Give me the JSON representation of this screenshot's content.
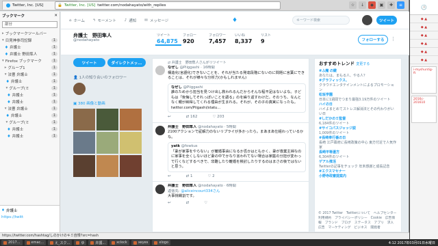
{
  "browser": {
    "tab_label": "Twitter, Inc. [US]",
    "url_site": "Twitter, Inc. [US]",
    "url": "twitter.com/nodahayato/with_replies",
    "status_url": "https://twitter.com/hashtag/しのかけのキミ自慢?src=hash"
  },
  "sidebar": {
    "title": "ブックマーク",
    "close": "✕",
    "search": "部分",
    "items": [
      {
        "label": "ブックマークツールバー",
        "count": ""
      },
      {
        "label": "日見神参司記録",
        "count": "1"
      },
      {
        "label": "弁護士",
        "count": "1"
      },
      {
        "label": "弁護士 野田隼人",
        "count": "1"
      },
      {
        "label": "Firefox ブックマーク",
        "count": "1"
      },
      {
        "label": "グループ1",
        "count": "1"
      },
      {
        "label": "法曹 弁護士",
        "count": "1"
      },
      {
        "label": "弁護士",
        "count": "1"
      },
      {
        "label": "グループ(ミ",
        "count": "1"
      },
      {
        "label": "弁護士",
        "count": "1"
      },
      {
        "label": "弁護士",
        "count": "1"
      },
      {
        "label": "法曹 弁護士",
        "count": "1"
      },
      {
        "label": "弁護士",
        "count": "1"
      },
      {
        "label": "グループ(ミ",
        "count": "1"
      },
      {
        "label": "弁護士",
        "count": "1"
      },
      {
        "label": "弁護士",
        "count": "1"
      }
    ],
    "bottom_name": "弁護士",
    "bottom_link": "https://twitt"
  },
  "nav": {
    "home": "ホーム",
    "moments": "モーメント",
    "notifications": "通知",
    "messages": "メッセージ",
    "search_placeholder": "キーワード検索",
    "tweet_button": "ツイート"
  },
  "profile": {
    "name": "弁護士　野田隼人",
    "handle": "@nodahayato",
    "stats": [
      {
        "label": "ツイート",
        "value": "64,875"
      },
      {
        "label": "フォロー",
        "value": "920"
      },
      {
        "label": "フォロワー",
        "value": "7,457"
      },
      {
        "label": "いいね",
        "value": "8,337"
      },
      {
        "label": "リスト",
        "value": "9"
      }
    ],
    "follow_button": "フォローする",
    "more": "⋮",
    "tweet_to": "ツイート",
    "dm": "ダイレクトメッ...",
    "known_followers": "1人の知り合いのフォロワー",
    "media_link": "380 画像と動画"
  },
  "feed": {
    "tweets": [
      {
        "context": "弁護士　野田隼人さんがリツイート",
        "name": "なぜし",
        "meta": "@Piiggashi · 16時間",
        "text": "構造化(言語化)できないことを、それが当たる発達段階にないのに問題に言葉にできることは、それが様々な分析力(かもしれません)",
        "quote_name": "なぜし",
        "quote_handle": "@Piiggashi",
        "quote_text": "誰のためから担当を見つけ出し救われるんだからそんな程不足はないよな。子どもは「後悔してそれっぽいことを語る」のを繰り返すわけだ。そのうち、なんとなく親が納得してくれる理由が生まれる。それが、その子の真実になったも。twitter.com/Piigashi/statu...",
        "replies": "↩",
        "retweets": "⇄ 162",
        "likes": "♡ 203"
      },
      {
        "context": "",
        "name": "弁護士　野田隼人",
        "meta": "@nodahayato · 5時間",
        "text": "2100アクションで証解力のないリプライが多かったら。まあまあ仕組わっているかな。",
        "quote_name": "yatk",
        "quote_handle": "@fewkus",
        "quote_text": "「妻が家事をやらない」が離婚事由になるか否かはともかく、妻が専業主婦なのに家事を全くしないほど妻の中でかなり言われてない場合は家庭の分担が変わって行くなどするべきで、非難したり離婚を検討したりするのはまさの後ではないと思う。",
        "replies": "↩",
        "retweets": "⇄ 1",
        "likes": "♡ 2"
      },
      {
        "context": "",
        "name": "弁護士　野田隼人",
        "meta": "@nodahayato · 6時間",
        "text": "@aliceincourt334さん",
        "quote_name": "",
        "quote_handle": "",
        "quote_text": "",
        "reply_to": "返信先:",
        "extra": "大事挑戦割です。",
        "replies": "↩",
        "retweets": "⇄",
        "likes": "♡"
      }
    ]
  },
  "trends": {
    "title": "おすすめトレンド",
    "change": "変更する",
    "items": [
      {
        "tag": "#ふ魔 の鍵",
        "desc": "あなたは、まもる人、やる人？"
      },
      {
        "tag": "#グラフィックス、",
        "desc": "クラウドエンタテインメントによるプロモーション"
      },
      {
        "tag": "松坂学園",
        "desc": "日本に1週間でつまり最強3.19万件のツイート"
      },
      {
        "tag": "ハイの日",
        "desc": "ハイよまとめてストレス解消法とその代わりがいい日"
      },
      {
        "tag": "#しだかのミ監督",
        "desc": "6,184件のツイート"
      },
      {
        "tag": "#サイコパスジャッジ説",
        "desc": "1,009件のツイート"
      },
      {
        "tag": "#長崎奉行番の日",
        "desc": "長崎 江戸幕府に長崎政策の中心 東方付近で人気作家"
      },
      {
        "tag": "長崎平等還方",
        "desc": "6,304件のツイート"
      },
      {
        "tag": "ゲアル推活",
        "desc": "Twitterの記事をチェック 年末感謝と成長記念"
      },
      {
        "tag": "#エクスマセナー",
        "desc": ""
      },
      {
        "tag": "小野寺政審提案内",
        "desc": ""
      }
    ]
  },
  "footer": {
    "lines": "© 2017 Twitter　Twitterについて　ヘルプセンター　利用規約　プライバシーポリシー　Cookie　広告情報　ブランド　ブログ　ステータス　アプリ　求人　広告　マーケティング　ビジネス　開発者　"
  },
  "statusbar": "https://twitter.com/hashtag/しのかけのキミ自慢?src=hash",
  "taskbar": {
    "items": [
      "2017...",
      "emac...",
      "え_スク...",
      "ゆ",
      "弁護...",
      "xclock",
      "xeyes",
      "xlogo"
    ],
    "clock": "4:12\n2017年03月01日水曜日"
  },
  "rightpanel": {
    "clock": "🕑",
    "url_snippet": "i-myshuntig-ft",
    "snippet2": "2016c-201610"
  }
}
